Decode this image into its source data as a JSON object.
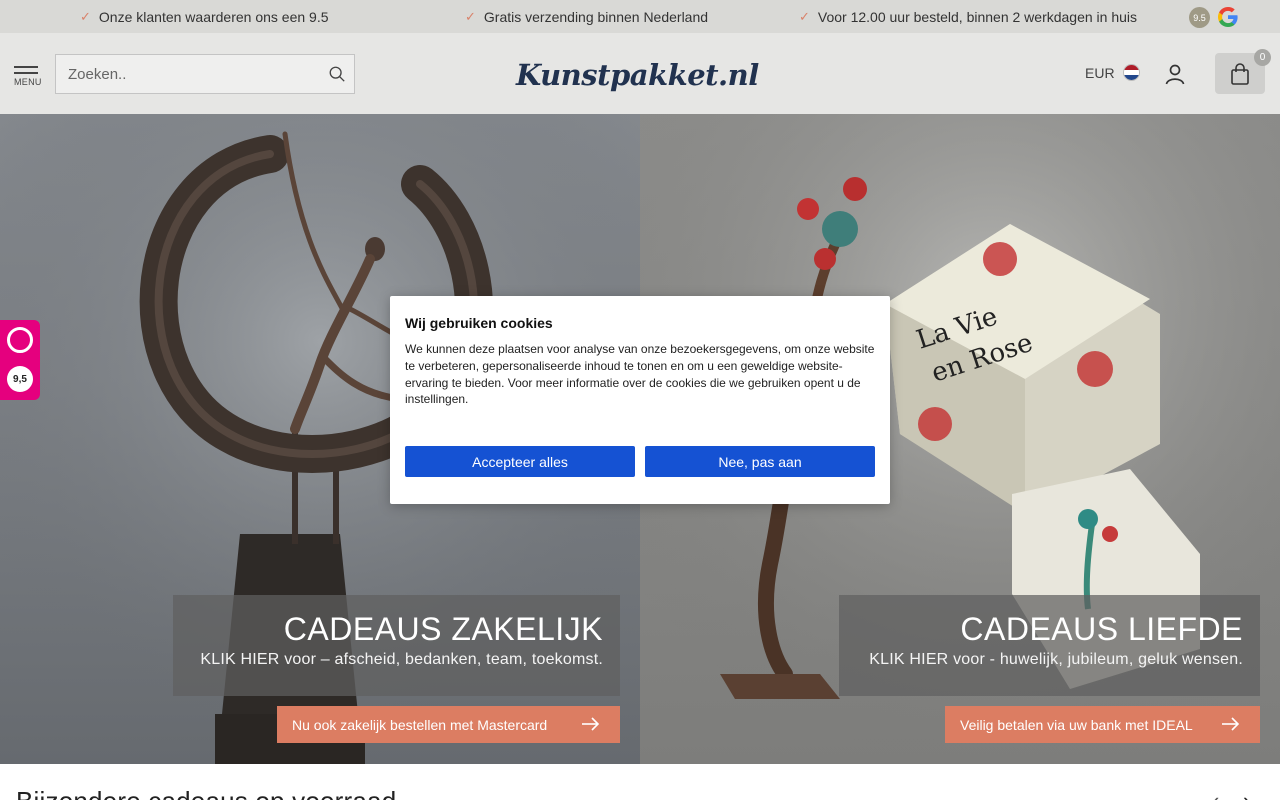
{
  "usps": [
    {
      "text": "Onze klanten waarderen ons een 9.5"
    },
    {
      "text": "Gratis verzending binnen Nederland"
    },
    {
      "text": "Voor 12.00 uur besteld, binnen 2 werkdagen in huis"
    }
  ],
  "top_rating": "9.5",
  "header": {
    "menu_label": "MENU",
    "search_placeholder": "Zoeken..",
    "logo_text": "Kunstpakket.nl",
    "currency": "EUR",
    "cart_count": "0"
  },
  "hero": {
    "left": {
      "title": "CADEAUS ZAKELIJK",
      "subtitle": "KLIK HIER voor – afscheid, bedanken, team, toekomst.",
      "cta": "Nu ook zakelijk bestellen met Mastercard"
    },
    "right": {
      "title": "CADEAUS LIEFDE",
      "subtitle": "KLIK HIER voor - huwelijk, jubileum, geluk wensen.",
      "cta": "Veilig betalen via uw bank met IDEAL",
      "box_text_line1": "La Vie",
      "box_text_line2": "en Rose"
    }
  },
  "kiyoh_score": "9,5",
  "cookie": {
    "title": "Wij gebruiken cookies",
    "body": "We kunnen deze plaatsen voor analyse van onze bezoekersgegevens, om onze website te verbeteren, gepersonaliseerde inhoud te tonen en om u een geweldige website-ervaring te bieden. Voor meer informatie over de cookies die we gebruiken opent u de instellingen.",
    "accept_label": "Accepteer alles",
    "decline_label": "Nee, pas aan"
  },
  "section": {
    "title": "Bijzondere cadeaus op voorraad"
  },
  "colors": {
    "accent": "#dc7d62",
    "cookie_button": "#1552d3",
    "kiyoh": "#e5007e",
    "logo": "#21324f"
  }
}
